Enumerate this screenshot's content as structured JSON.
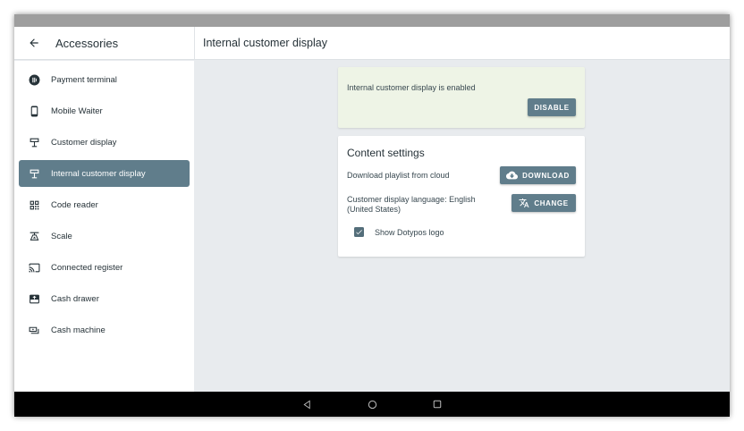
{
  "header": {
    "back_icon": "arrow-left-icon",
    "section_title": "Accessories",
    "page_title": "Internal customer display"
  },
  "sidebar": {
    "items": [
      {
        "label": "Payment terminal",
        "icon": "payment-terminal-icon",
        "active": false
      },
      {
        "label": "Mobile Waiter",
        "icon": "phone-icon",
        "active": false
      },
      {
        "label": "Customer display",
        "icon": "customer-display-icon",
        "active": false
      },
      {
        "label": "Internal customer display",
        "icon": "customer-display-icon",
        "active": true
      },
      {
        "label": "Code reader",
        "icon": "qr-code-icon",
        "active": false
      },
      {
        "label": "Scale",
        "icon": "scale-icon",
        "active": false
      },
      {
        "label": "Connected register",
        "icon": "cast-icon",
        "active": false
      },
      {
        "label": "Cash drawer",
        "icon": "cash-drawer-icon",
        "active": false
      },
      {
        "label": "Cash machine",
        "icon": "cash-machine-icon",
        "active": false
      }
    ]
  },
  "status_card": {
    "text": "Internal customer display is enabled",
    "button": "DISABLE"
  },
  "content_settings": {
    "title": "Content settings",
    "playlist_label": "Download playlist from cloud",
    "download_button": "DOWNLOAD",
    "language_line1": "Customer display language: English",
    "language_line2": "(United States)",
    "change_button": "CHANGE",
    "logo_checkbox_label": "Show Dotypos logo",
    "logo_checkbox_checked": true
  },
  "colors": {
    "accent": "#607d8b",
    "enabled_card_bg": "#eef4e6",
    "background": "#e8ebee"
  }
}
